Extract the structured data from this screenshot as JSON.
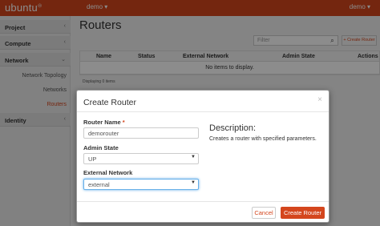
{
  "topbar": {
    "logo": "ubuntu",
    "project": "demo ▾",
    "user": "demo ▾"
  },
  "sidebar": {
    "sections": [
      {
        "label": "Project",
        "chevron": "‹"
      },
      {
        "label": "Compute",
        "chevron": "‹"
      },
      {
        "label": "Network",
        "chevron": "⌄"
      },
      {
        "label": "Identity",
        "chevron": "‹"
      }
    ],
    "items": [
      "Network Topology",
      "Networks",
      "Routers"
    ]
  },
  "main": {
    "title": "Routers",
    "filter_placeholder": "Filter",
    "create_label": "+ Create Router",
    "columns": [
      "Name",
      "Status",
      "External Network",
      "Admin State",
      "Actions"
    ],
    "empty_text": "No items to display.",
    "footer": "Displaying 0 items"
  },
  "modal": {
    "title": "Create Router",
    "close": "×",
    "router_name_label": "Router Name",
    "router_name_required": "*",
    "router_name_value": "demorouter",
    "admin_state_label": "Admin State",
    "admin_state_value": "UP",
    "external_network_label": "External Network",
    "external_network_value": "external",
    "description_title": "Description:",
    "description_text": "Creates a router with specified parameters.",
    "cancel_label": "Cancel",
    "create_label": "Create Router"
  },
  "colors": {
    "accent": "#d4461d"
  }
}
